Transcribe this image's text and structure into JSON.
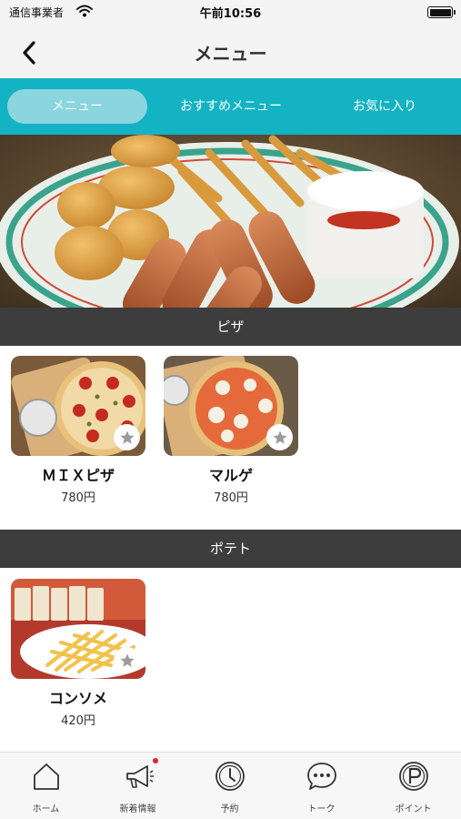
{
  "status_bar": {
    "carrier": "通信事業者",
    "time": "午前10:56"
  },
  "nav": {
    "title": "メニュー",
    "back_icon": "chevron-left-icon"
  },
  "tabs": [
    {
      "label": "メニュー",
      "active": true
    },
    {
      "label": "おすすめメニュー",
      "active": false
    },
    {
      "label": "お気に入り",
      "active": false
    }
  ],
  "sections": [
    {
      "title": "ピザ",
      "items": [
        {
          "name": "ＭＩＸピザ",
          "price": "780円"
        },
        {
          "name": "マルゲ",
          "price": "780円"
        }
      ]
    },
    {
      "title": "ポテト",
      "items": [
        {
          "name": "コンソメ",
          "price": "420円"
        }
      ]
    }
  ],
  "bottom_nav": [
    {
      "label": "ホーム",
      "icon": "home-icon"
    },
    {
      "label": "新着情報",
      "icon": "megaphone-icon"
    },
    {
      "label": "予約",
      "icon": "clock-icon"
    },
    {
      "label": "トーク",
      "icon": "chat-bubble-icon"
    },
    {
      "label": "ポイント",
      "icon": "point-icon"
    }
  ],
  "colors": {
    "accent": "#14b3c4",
    "tab_active": "#8ad5de",
    "section_header": "#3d3d3d",
    "notification": "#e0242b"
  }
}
